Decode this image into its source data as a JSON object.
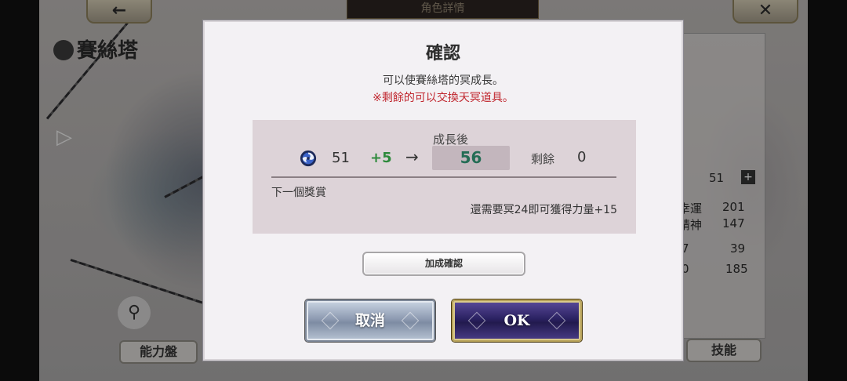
{
  "background": {
    "screen_title": "角色詳情",
    "back_icon": "←",
    "close_icon": "✕",
    "character_name": "賽絲塔",
    "stats": {
      "stat1_value": "51",
      "luck_label": "幸運",
      "luck_value": "201",
      "spirit_label": "精神",
      "spirit_value": "147",
      "stat_a_value": "39",
      "stat_b_value": "185",
      "partial_a": "7",
      "partial_b": "0"
    },
    "ability_board_label": "能力盤",
    "skills_label": "技能"
  },
  "dialog": {
    "title": "確認",
    "message": "可以使賽絲塔的冥成長。",
    "warning": "※剩餘的可以交換天冥道具。",
    "after_growth_label": "成長後",
    "current_value": "51",
    "increase": "+5",
    "arrow": "→",
    "after_value": "56",
    "remaining_label": "剩餘",
    "remaining_value": "0",
    "next_reward_label": "下一個獎賞",
    "next_reward_requirement": "還需要冥24即可獲得力量+15",
    "bonus_confirm_button": "加成確認",
    "cancel_button": "取消",
    "ok_button": "OK"
  },
  "colors": {
    "increase": "#2e8a3c",
    "after_value": "#246d55",
    "warning": "#c0262e"
  }
}
